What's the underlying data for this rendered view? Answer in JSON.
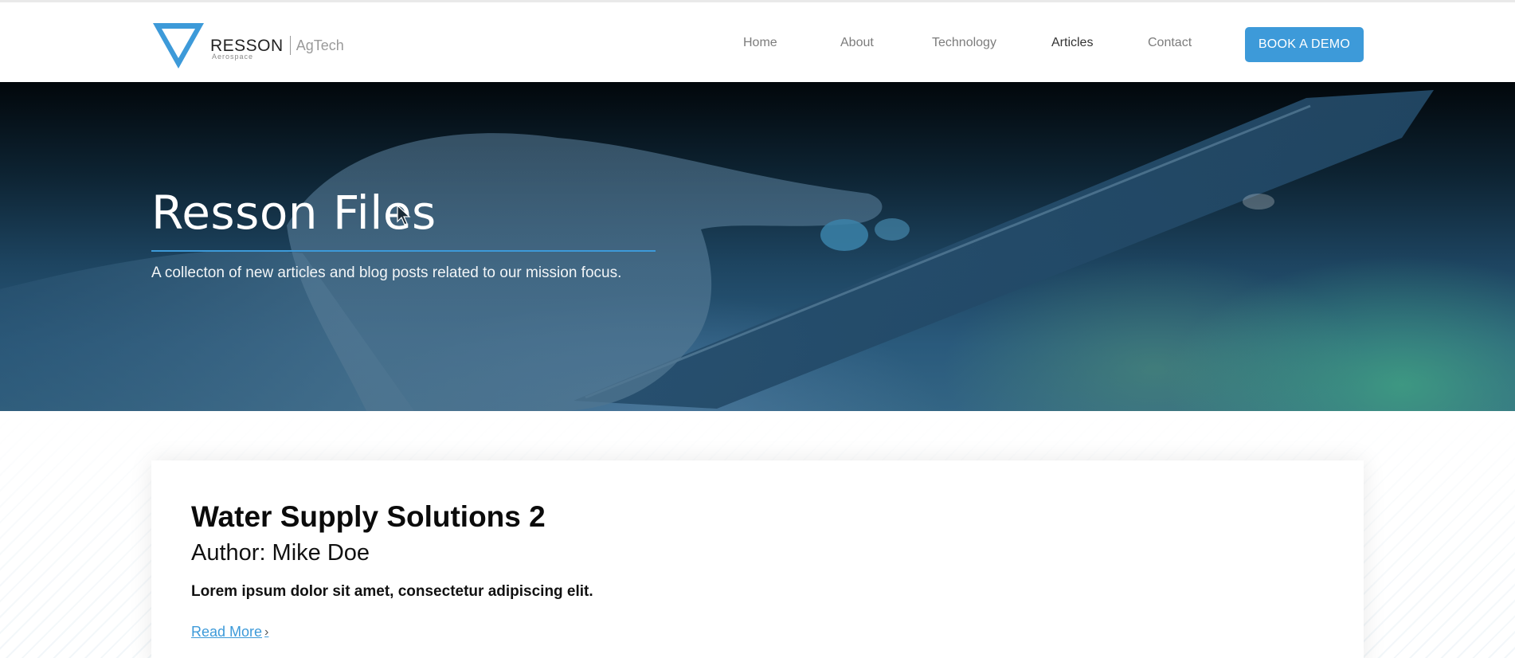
{
  "header": {
    "logo": {
      "wordmark": "RESSON",
      "sub": "Aerospace",
      "tag": "AgTech"
    },
    "nav": [
      {
        "label": "Home",
        "active": false
      },
      {
        "label": "About",
        "active": false
      },
      {
        "label": "Technology",
        "active": false
      },
      {
        "label": "Articles",
        "active": true
      },
      {
        "label": "Contact",
        "active": false
      }
    ],
    "cta_label": "BOOK A DEMO"
  },
  "hero": {
    "title": "Resson Files",
    "subtitle": "A collecton of new articles and blog posts related to our mission focus."
  },
  "articles": [
    {
      "title": "Water Supply Solutions 2",
      "author": "Author: Mike Doe",
      "excerpt": "Lorem ipsum dolor sit amet, consectetur adipiscing elit.",
      "read_more": "Read More",
      "read_more_icon": "chevron-right-icon"
    }
  ],
  "colors": {
    "accent": "#3d9ad9",
    "nav_text": "#7c7c7c",
    "nav_active": "#333333"
  }
}
